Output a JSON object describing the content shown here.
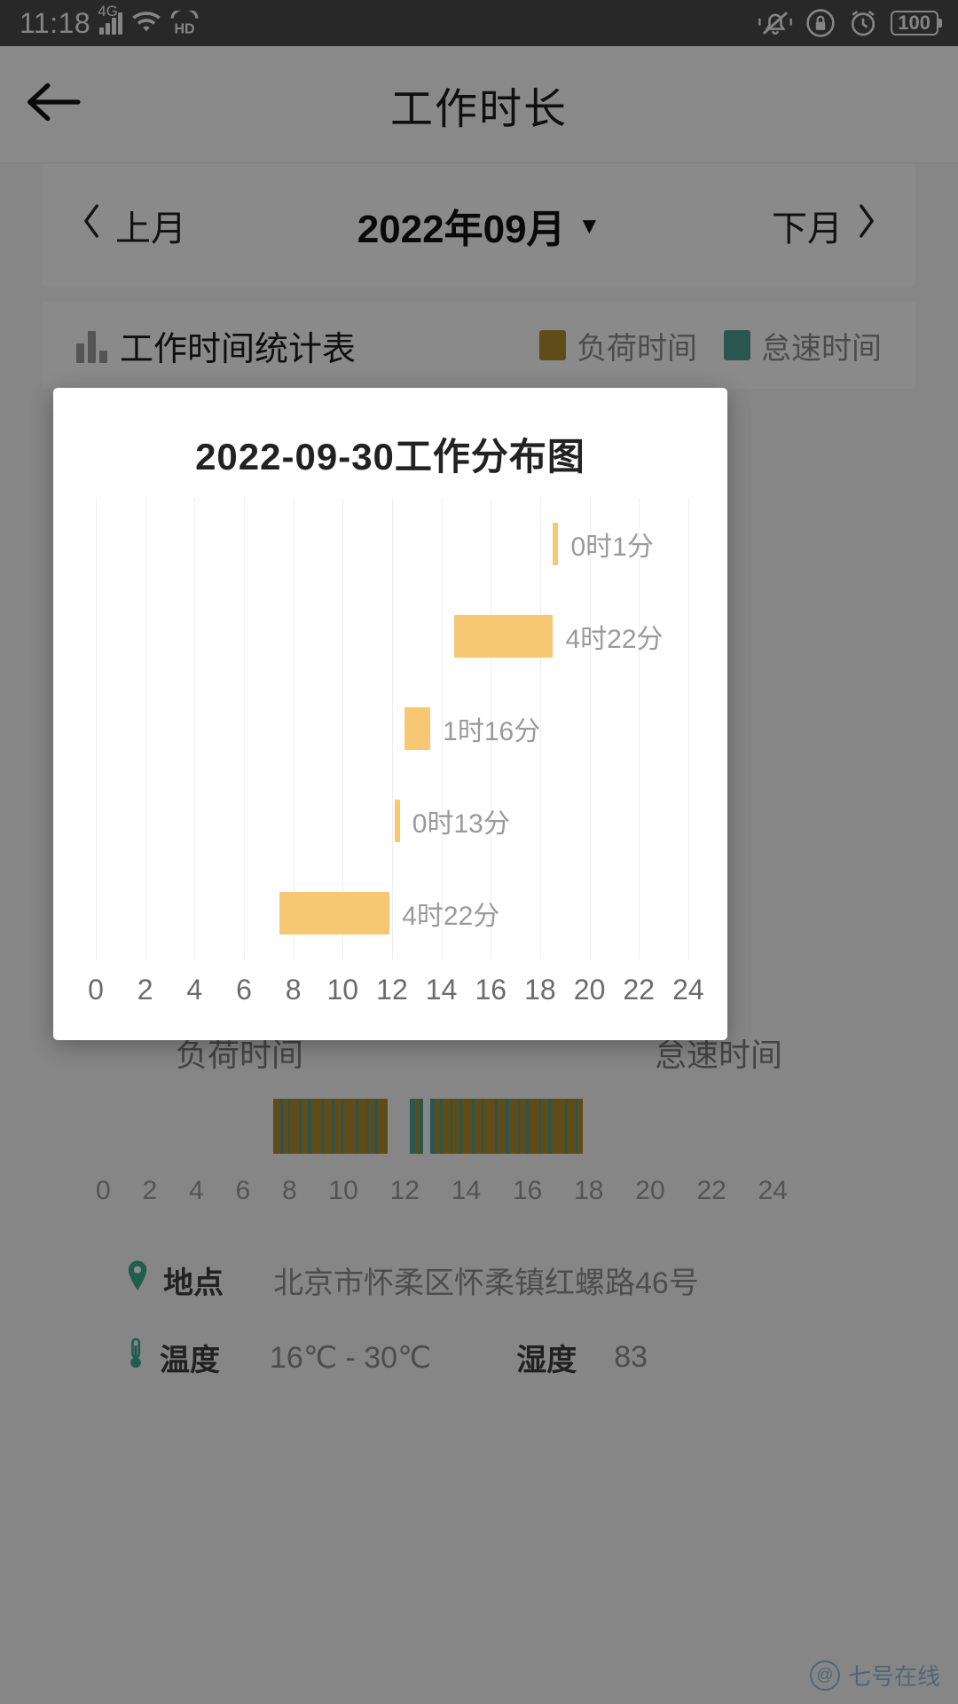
{
  "status_bar": {
    "time": "11:18",
    "network": "4G",
    "icons": [
      "signal-icon",
      "wifi-icon",
      "hd-icon",
      "mute-bell-icon",
      "rotation-lock-icon",
      "alarm-clock-icon"
    ],
    "battery": "100"
  },
  "header": {
    "title": "工作时长",
    "back_icon": "back-arrow-icon"
  },
  "month_selector": {
    "prev_label": "上月",
    "current": "2022年09月",
    "next_label": "下月",
    "caret": "▼"
  },
  "stats_header": {
    "title": "工作时间统计表",
    "legend": [
      {
        "label": "负荷时间",
        "color": "#b08a2e"
      },
      {
        "label": "怠速时间",
        "color": "#4c9e93"
      }
    ]
  },
  "axis_ticks": [
    "0",
    "2",
    "4",
    "6",
    "8",
    "10",
    "12",
    "14",
    "16",
    "18",
    "20",
    "22",
    "24"
  ],
  "segment_titles": [
    "负荷时间",
    "怠速时间"
  ],
  "info": {
    "location_label": "地点",
    "location_value": "北京市怀柔区怀柔镇红螺路46号",
    "location_icon": "map-pin-icon",
    "temperature_label": "温度",
    "temperature_value": "16℃ - 30℃",
    "temperature_icon": "thermometer-icon",
    "humidity_label": "湿度",
    "humidity_value": "83"
  },
  "watermark": {
    "text": "七号在线",
    "icon": "watermark-circle-icon"
  },
  "modal": {
    "title": "2022-09-30工作分布图"
  },
  "chart_data": {
    "type": "bar",
    "title": "2022-09-30工作分布图",
    "xlabel": "",
    "ylabel": "",
    "xlim": [
      0,
      24
    ],
    "grid": true,
    "orientation": "horizontal",
    "bar_color": "#f7c873",
    "xticks": [
      "0",
      "2",
      "4",
      "6",
      "8",
      "10",
      "12",
      "14",
      "16",
      "18",
      "20",
      "22",
      "24"
    ],
    "bars": [
      {
        "label": "0时1分",
        "start": 18.52,
        "end": 18.57,
        "hours": 0.017,
        "row": 0
      },
      {
        "label": "4时22分",
        "start": 14.52,
        "end": 18.52,
        "hours": 4.367,
        "row": 1
      },
      {
        "label": "1时16分",
        "start": 12.5,
        "end": 13.55,
        "hours": 1.267,
        "row": 2
      },
      {
        "label": "0时13分",
        "start": 12.1,
        "end": 12.25,
        "hours": 0.217,
        "row": 3
      },
      {
        "label": "4时22分",
        "start": 7.45,
        "end": 11.9,
        "hours": 4.367,
        "row": 4
      }
    ]
  }
}
